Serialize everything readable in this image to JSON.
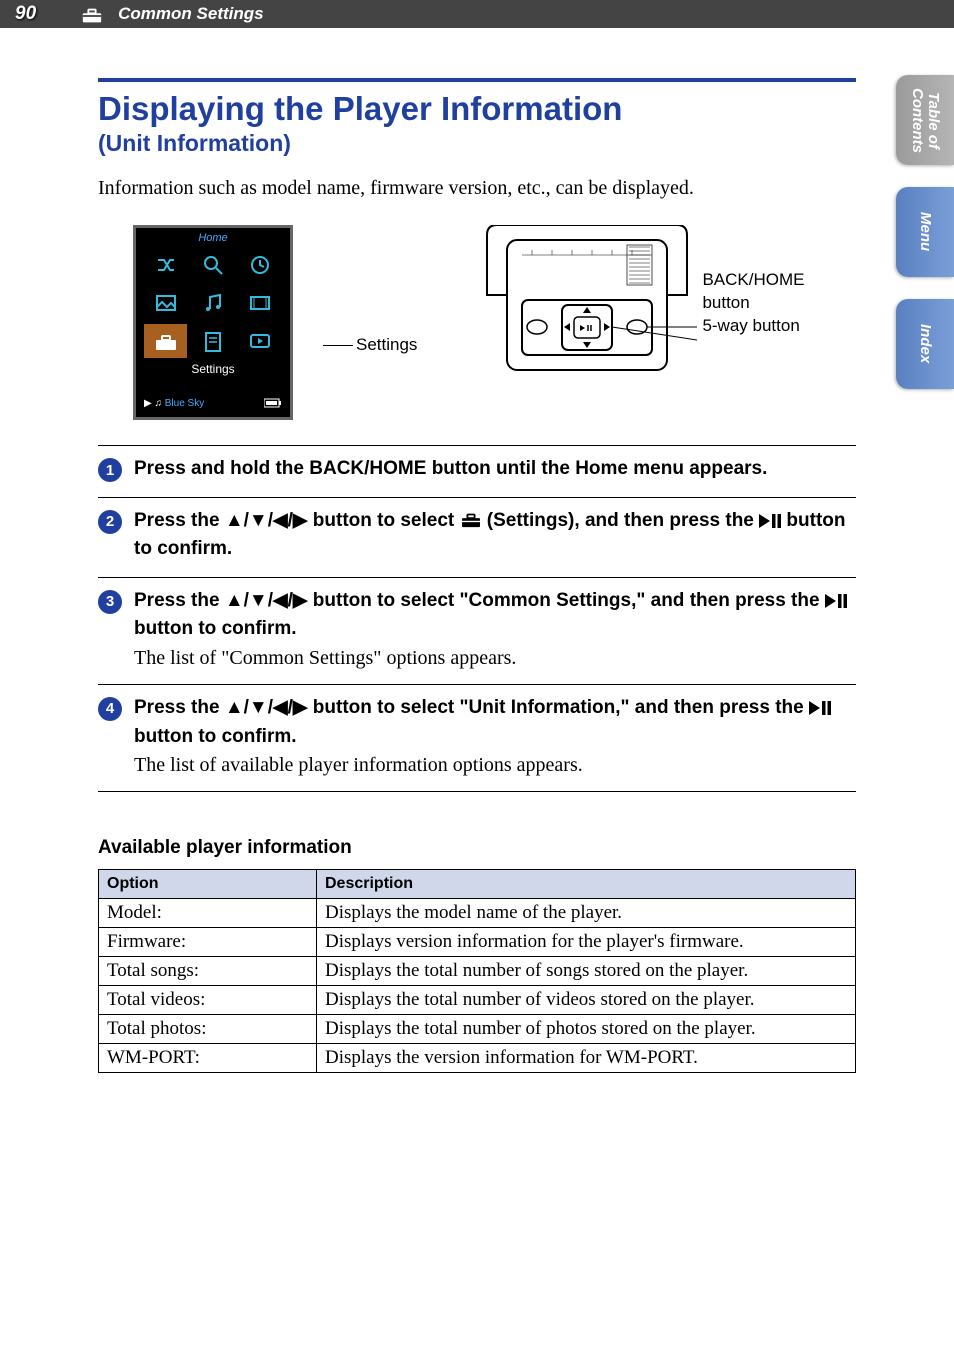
{
  "header": {
    "page_number": "90",
    "section": "Common Settings"
  },
  "side_tabs": {
    "toc": "Table of\nContents",
    "menu": "Menu",
    "index": "Index"
  },
  "title": {
    "main": "Displaying the Player Information",
    "sub": "(Unit Information)"
  },
  "intro": "Information such as model name, firmware version, etc., can be displayed.",
  "diagram": {
    "screen_home": "Home",
    "screen_label": "Settings",
    "now_playing_prefix": "▶ ♫",
    "now_playing": "Blue Sky",
    "pointer_label": "Settings",
    "device_label1": "BACK/HOME",
    "device_label1b": "button",
    "device_label2": "5-way button"
  },
  "steps": [
    {
      "n": "1",
      "html": "Press and hold the BACK/HOME button until the Home menu appears.",
      "sub": ""
    },
    {
      "n": "2",
      "html": "Press the ▲/▼/◀/▶ button to select [TOOLBOX] (Settings), and then press the ▶❙❙ button to confirm.",
      "sub": ""
    },
    {
      "n": "3",
      "html": "Press the ▲/▼/◀/▶ button to select \"Common Settings,\" and then press the ▶❙❙ button to confirm.",
      "sub": "The list of \"Common Settings\" options appears."
    },
    {
      "n": "4",
      "html": "Press the ▲/▼/◀/▶ button to select \"Unit Information,\" and then press the ▶❙❙ button to confirm.",
      "sub": "The list of available player information options appears."
    }
  ],
  "table_section": {
    "heading": "Available player information",
    "col1": "Option",
    "col2": "Description",
    "rows": [
      {
        "opt": "Model:",
        "desc": "Displays the model name of the player."
      },
      {
        "opt": "Firmware:",
        "desc": "Displays version information for the player's firmware."
      },
      {
        "opt": "Total songs:",
        "desc": "Displays the total number of songs stored on the player."
      },
      {
        "opt": "Total videos:",
        "desc": "Displays the total number of videos stored on the player."
      },
      {
        "opt": "Total photos:",
        "desc": "Displays the total number of photos stored on the player."
      },
      {
        "opt": "WM-PORT:",
        "desc": "Displays the version information for WM-PORT."
      }
    ]
  }
}
